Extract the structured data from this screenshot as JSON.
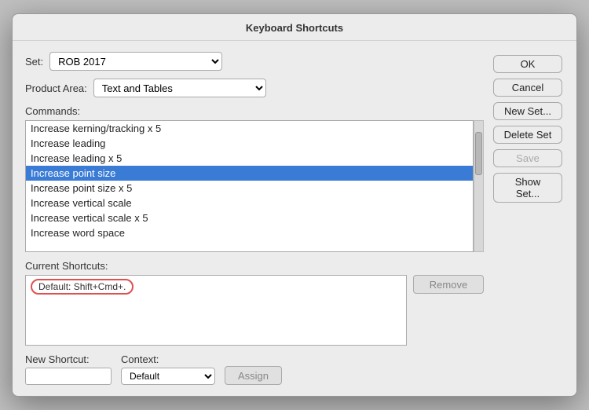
{
  "dialog": {
    "title": "Keyboard Shortcuts",
    "set_label": "Set:",
    "set_value": "ROB 2017",
    "product_area_label": "Product Area:",
    "product_area_value": "Text and Tables",
    "commands_label": "Commands:",
    "commands_list": [
      {
        "text": "Increase kerning/tracking x 5",
        "selected": false
      },
      {
        "text": "Increase leading",
        "selected": false
      },
      {
        "text": "Increase leading x 5",
        "selected": false
      },
      {
        "text": "Increase point size",
        "selected": true
      },
      {
        "text": "Increase point size x 5",
        "selected": false
      },
      {
        "text": "Increase vertical scale",
        "selected": false
      },
      {
        "text": "Increase vertical scale x 5",
        "selected": false
      },
      {
        "text": "Increase word space",
        "selected": false
      }
    ],
    "current_shortcuts_label": "Current Shortcuts:",
    "current_shortcut_value": "Default: Shift+Cmd+.",
    "remove_label": "Remove",
    "new_shortcut_label": "New Shortcut:",
    "new_shortcut_placeholder": "",
    "context_label": "Context:",
    "context_value": "Default",
    "context_options": [
      "Default"
    ],
    "assign_label": "Assign",
    "buttons": {
      "ok": "OK",
      "cancel": "Cancel",
      "new_set": "New Set...",
      "delete_set": "Delete Set",
      "save": "Save",
      "show_set": "Show Set..."
    }
  }
}
